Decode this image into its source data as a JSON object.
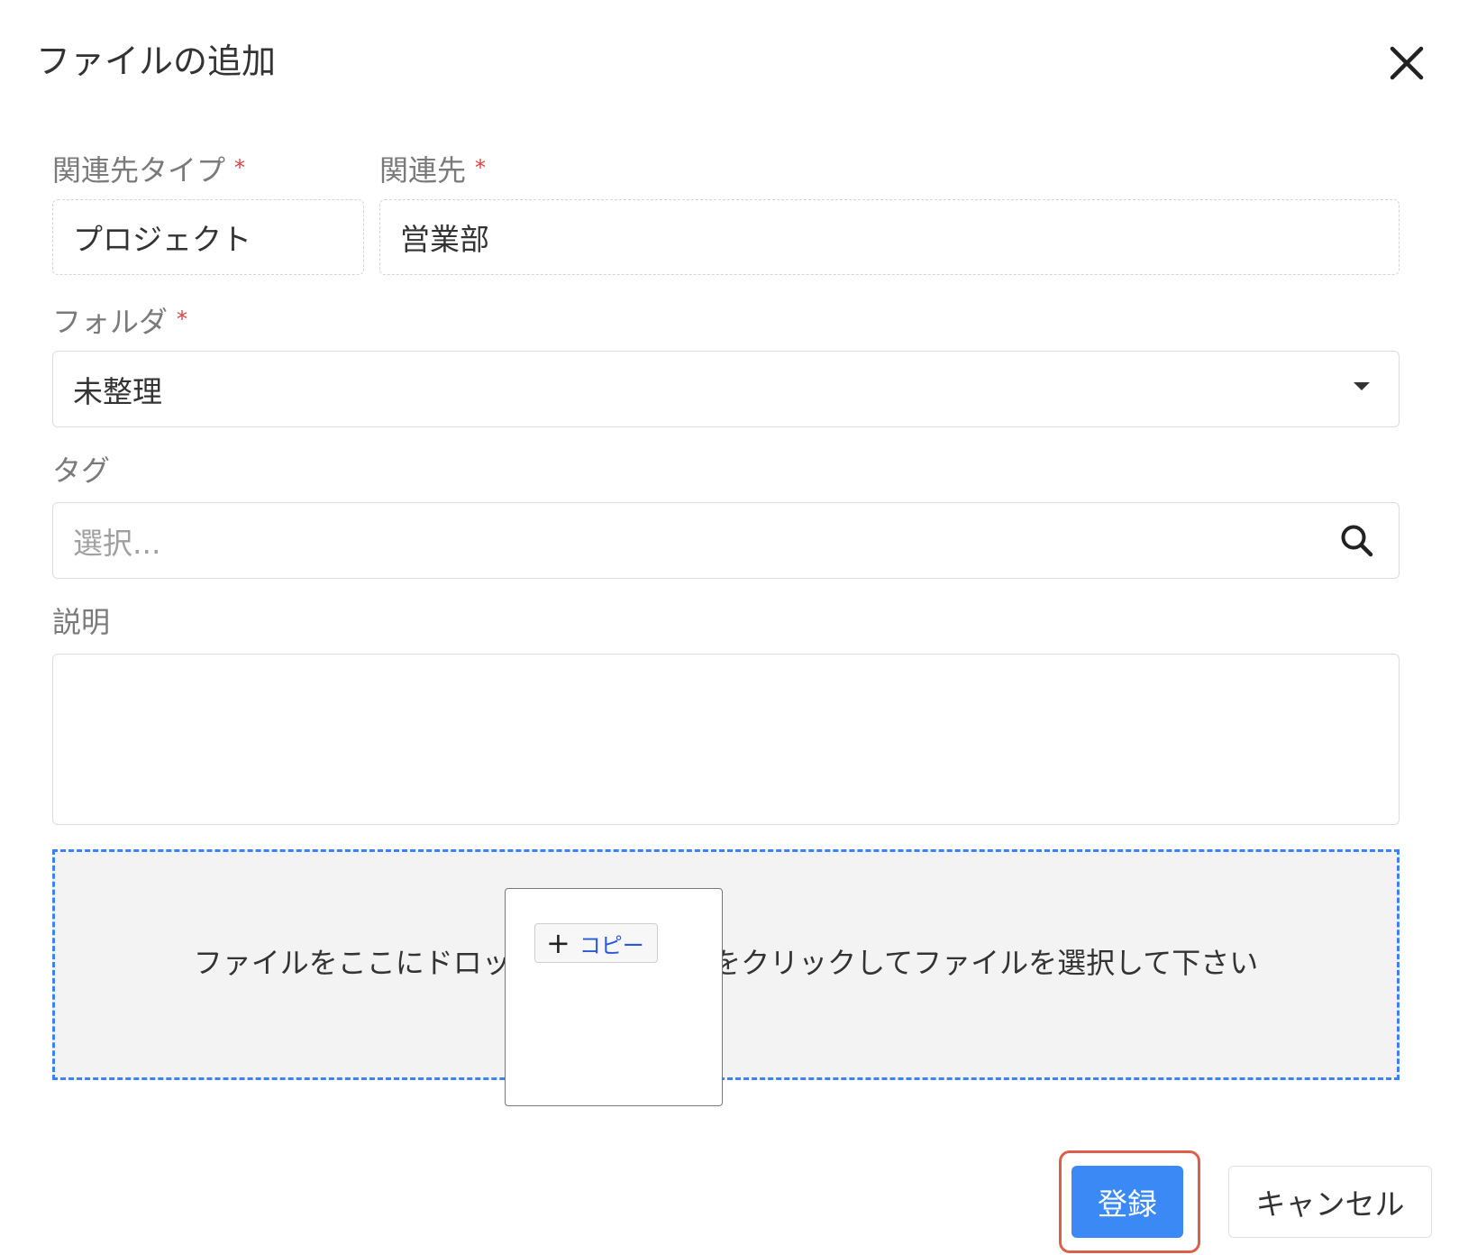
{
  "dialog": {
    "title": "ファイルの追加"
  },
  "form": {
    "related_type": {
      "label": "関連先タイプ",
      "required_mark": "*",
      "value": "プロジェクト"
    },
    "related_to": {
      "label": "関連先",
      "required_mark": "*",
      "value": "営業部"
    },
    "folder": {
      "label": "フォルダ",
      "required_mark": "*",
      "value": "未整理"
    },
    "tags": {
      "label": "タグ",
      "placeholder": "選択..."
    },
    "description": {
      "label": "説明",
      "value": ""
    }
  },
  "dropzone": {
    "text": "ファイルをここにドロップするか、ここをクリックしてファイルを選択して下さい"
  },
  "drag_preview": {
    "badge_icon": "plus-icon",
    "badge_label": "コピー"
  },
  "buttons": {
    "register": "登録",
    "cancel": "キャンセル"
  },
  "colors": {
    "primary": "#3b89f5",
    "required": "#e04040",
    "dropzone_border": "#3b82f6",
    "highlight": "#dc5f4b"
  }
}
